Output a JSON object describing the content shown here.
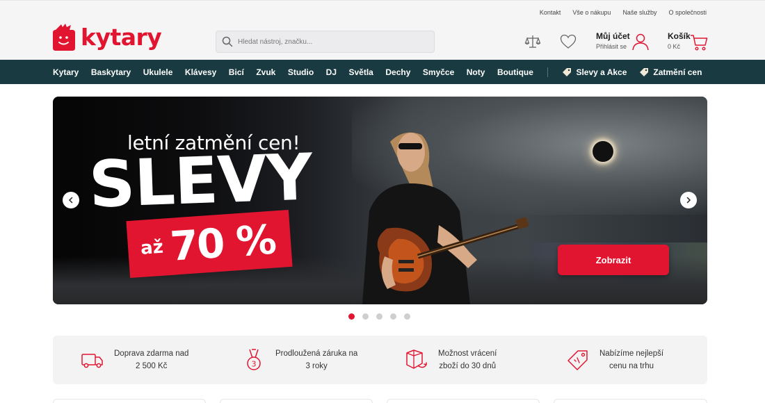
{
  "top_links": [
    "Kontakt",
    "Vše o nákupu",
    "Naše služby",
    "O společnosti"
  ],
  "logo": {
    "text": "kytary"
  },
  "search": {
    "placeholder": "Hledat nástroj, značku..."
  },
  "account": {
    "title": "Můj účet",
    "subtitle": "Přihlásit se"
  },
  "cart": {
    "title": "Košík",
    "amount": "0 Kč"
  },
  "nav": {
    "items": [
      "Kytary",
      "Baskytary",
      "Ukulele",
      "Klávesy",
      "Bicí",
      "Zvuk",
      "Studio",
      "DJ",
      "Světla",
      "Dechy",
      "Smyčce",
      "Noty",
      "Boutique"
    ],
    "special": [
      "Slevy a Akce",
      "Zatmění cen"
    ]
  },
  "banner": {
    "subtitle": "letní zatmění cen!",
    "headline": "SLEVY",
    "tag_prefix": "až",
    "tag_value": "70 %",
    "cta": "Zobrazit",
    "slide_count": 5,
    "active_slide": 1
  },
  "benefits": [
    {
      "line1": "Doprava zdarma nad",
      "line2": "2 500 Kč",
      "icon": "truck-icon"
    },
    {
      "line1": "Prodloužená záruka na",
      "line2": "3 roky",
      "icon": "medal-icon"
    },
    {
      "line1": "Možnost vrácení",
      "line2": "zboží do 30 dnů",
      "icon": "return-box-icon"
    },
    {
      "line1": "Nabízíme nejlepší",
      "line2": "cenu na trhu",
      "icon": "price-tag-icon"
    }
  ],
  "colors": {
    "brand_red": "#e21531",
    "nav_bg": "#183a40",
    "top_bg": "#f5f5f6"
  }
}
